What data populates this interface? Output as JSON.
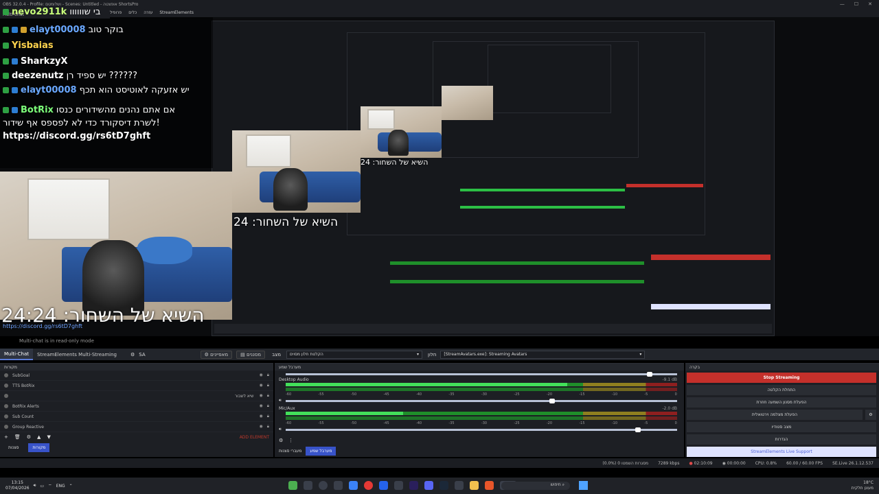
{
  "window": {
    "title": "OBS 32.0.4 - Profile: ושלומטם - Scenes: Untitled - אופצטה ShortsPro"
  },
  "menu": [
    "StreamElements",
    "עזרה",
    "כלים",
    "פרופיל"
  ],
  "chat": {
    "title": "Multi-Chat",
    "rows": [
      {
        "name": "nevo2911k",
        "text": "בי שוווווו",
        "color": "#c8ff7a"
      },
      {
        "name": "elayt00008",
        "text": "בוקר טוב",
        "color": "#6aa8ff"
      },
      {
        "name": "Yisbaias",
        "text": "",
        "color": "#ffd34d"
      },
      {
        "name": "SharkzyX",
        "text": "",
        "color": "#ffffff"
      },
      {
        "name": "deezenutz",
        "text": "יש ספיד רן ??????",
        "color": "#ffffff"
      },
      {
        "name": "elayt00008",
        "text": "יש אזעקה לאוטיסט הוא תכף",
        "color": "#6aa8ff"
      },
      {
        "name": "BotRix",
        "text": "אם אתם נהנים מהשידורים כנסו",
        "color": "#7dff7a"
      },
      {
        "name": "",
        "text": "לשרת דיסקורד כדי לא לפספס אף שידור!",
        "color": "#ffffff"
      },
      {
        "name": "",
        "text": "https://discord.gg/rs6tD7ghft",
        "color": "#ffffff"
      }
    ],
    "readonly": "Multi-chat is in read-only mode",
    "small_link": "https://discord.gg/rs6tD7ghft"
  },
  "caption": {
    "main": "השיא של השחור: 24:24",
    "mid": "השיא של השחור: 24",
    "small": "השיא של השחור: 24"
  },
  "scenebar": {
    "tabs": [
      "Multi-Chat",
      "StreamElements Multi-Streaming"
    ],
    "scene_label": "SA",
    "pill1": "מאפיינים",
    "pill2": "מסננים",
    "label_mode": "מצב",
    "combo1": "הקלטת חלון מסוים",
    "label_window": "חלון",
    "combo2": "[StreamAvatars.exe]: Streaming Avatars"
  },
  "sources": {
    "title": "מקורות",
    "items": [
      "SubGoal",
      "TTS BotRix",
      "שיא לשבור",
      "BotRix Alerts",
      "Sub Count",
      "Group Reactive"
    ],
    "add_element": "ADD ELEMENT",
    "tabs": [
      "סצנות",
      "מקורות"
    ]
  },
  "mixer": {
    "title": "מערבל שמע",
    "tracks": [
      {
        "name": "Desktop Audio",
        "db": "-9.1 dB",
        "level": 0.72,
        "volume": 0.93
      },
      {
        "name": "Mic/Aux",
        "db": "-2.0 dB",
        "level": 0.3,
        "volume": 0.9
      }
    ],
    "ticks": [
      "-60",
      "-55",
      "-50",
      "-45",
      "-40",
      "-35",
      "-30",
      "-25",
      "-20",
      "-15",
      "-10",
      "-5",
      "0"
    ],
    "tabs": [
      "מעברי סצנות",
      "מערבל שמע"
    ]
  },
  "controls": {
    "title": "בקרה",
    "buttons": [
      "Stop Streaming",
      "התחלת הקלטה",
      "הפעלת מסנון השמעה חוזרת",
      "הפעלת מצלמה וירטואלית",
      "מצב סטודיו",
      "הגדרות",
      "StreamElements Live Support"
    ]
  },
  "status": {
    "dropped": "(0.0%) מסגרות השמטו 0",
    "bitrate": "7289 kbps",
    "live_time": "02:10:09",
    "rec_time": "00:00:00",
    "cpu": "CPU: 0.8%",
    "fps": "60.00 / 60.00 FPS",
    "version": "SE.Live 26.1.12.537"
  },
  "taskbar": {
    "time": "13:15",
    "date": "07/04/2026",
    "lang": "ENG",
    "search": "חיפוש",
    "weather": "18°C",
    "weather_desc": "מעונן חלקית"
  }
}
